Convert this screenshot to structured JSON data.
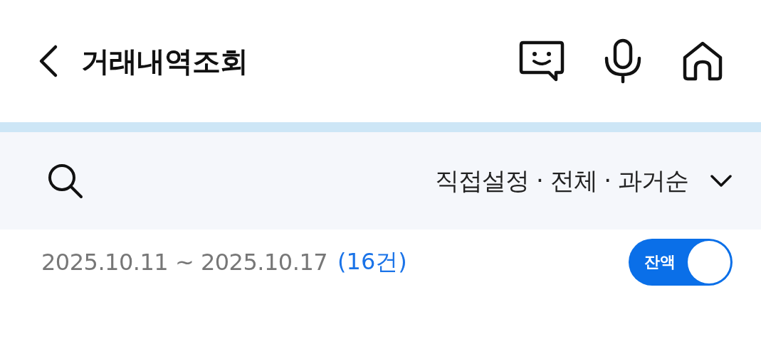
{
  "header": {
    "title": "거래내역조회"
  },
  "filter": {
    "summary": "직접설정 · 전체 · 과거순"
  },
  "period": {
    "range": "2025.10.11 ~ 2025.10.17",
    "count": "(16건)"
  },
  "balance_toggle": {
    "label": "잔액",
    "on": true
  }
}
